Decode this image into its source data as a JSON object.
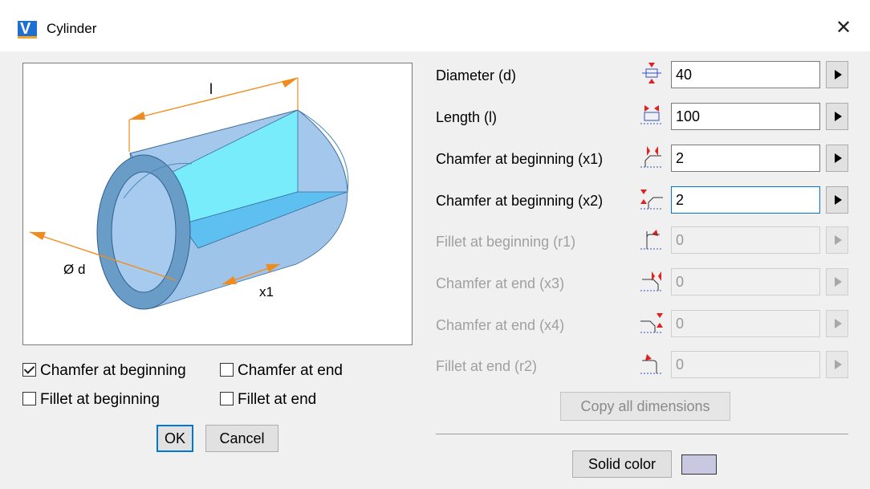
{
  "window": {
    "title": "Cylinder",
    "app_icon_letter": "V"
  },
  "diagram": {
    "label_length": "l",
    "label_diameter": "Ø d",
    "label_chamfer": "x1"
  },
  "options": {
    "chamfer_beginning": {
      "label": "Chamfer at beginning",
      "checked": true
    },
    "chamfer_end": {
      "label": "Chamfer at end",
      "checked": false
    },
    "fillet_beginning": {
      "label": "Fillet at beginning",
      "checked": false
    },
    "fillet_end": {
      "label": "Fillet at end",
      "checked": false
    }
  },
  "buttons": {
    "ok": "OK",
    "cancel": "Cancel",
    "copy": "Copy all dimensions",
    "solid_color": "Solid color"
  },
  "fields": [
    {
      "label": "Diameter (d)",
      "value": "40",
      "enabled": true
    },
    {
      "label": "Length (l)",
      "value": "100",
      "enabled": true
    },
    {
      "label": "Chamfer at beginning (x1)",
      "value": "2",
      "enabled": true
    },
    {
      "label": "Chamfer at beginning (x2)",
      "value": "2",
      "enabled": true
    },
    {
      "label": "Fillet at beginning (r1)",
      "value": "0",
      "enabled": false
    },
    {
      "label": "Chamfer at end (x3)",
      "value": "0",
      "enabled": false
    },
    {
      "label": "Chamfer at end (x4)",
      "value": "0",
      "enabled": false
    },
    {
      "label": "Fillet at end (r2)",
      "value": "0",
      "enabled": false
    }
  ],
  "colors": {
    "solid_color": "#c8c8e0",
    "accent": "#0078d7",
    "dim_arrow": "#f08c1e"
  }
}
